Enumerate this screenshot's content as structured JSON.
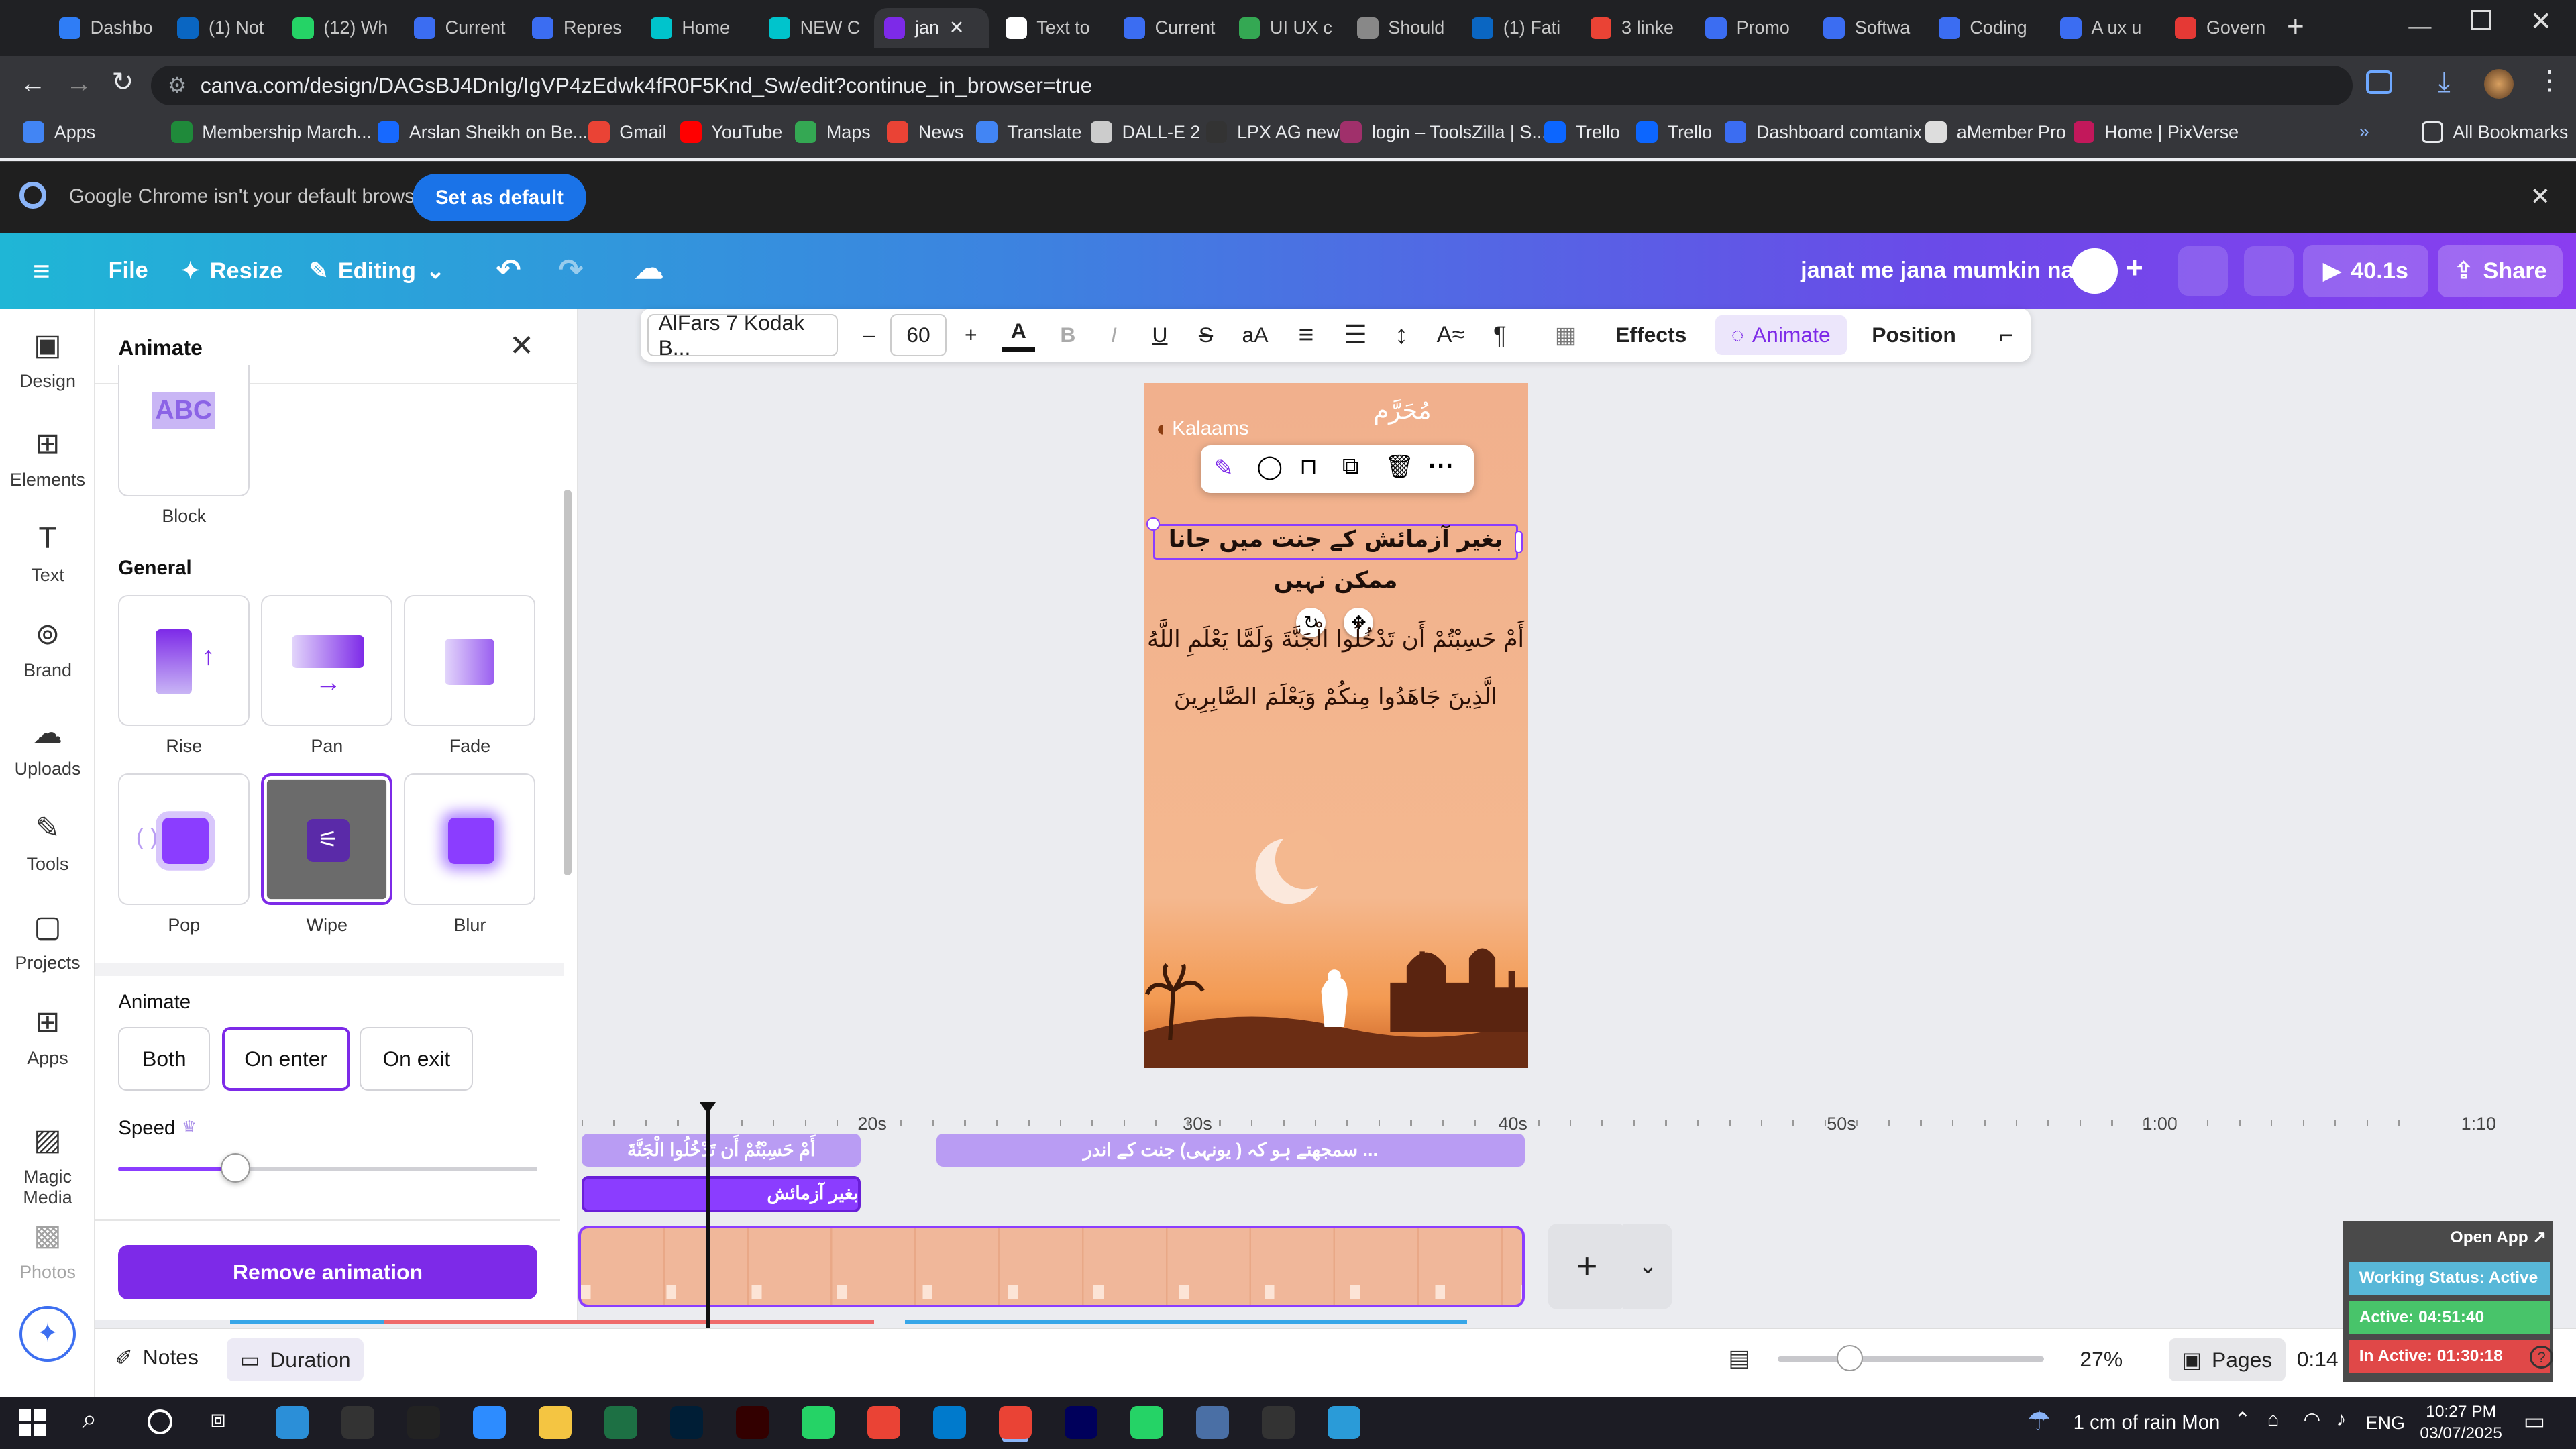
{
  "browser": {
    "tabs": [
      {
        "label": "Dashbo",
        "color": "#2f7df6"
      },
      {
        "label": "(1) Not",
        "color": "#0a66c2"
      },
      {
        "label": "(12) Wh",
        "color": "#25d366"
      },
      {
        "label": "Current",
        "color": "#3b6df2"
      },
      {
        "label": "Repres",
        "color": "#3b6df2"
      },
      {
        "label": "Home",
        "color": "#00c4cc"
      },
      {
        "label": "NEW C",
        "color": "#00c4cc"
      },
      {
        "label": "jan",
        "color": "#7d2ae8"
      },
      {
        "label": "Text to",
        "color": "#ffffff"
      },
      {
        "label": "Current",
        "color": "#3b6df2"
      },
      {
        "label": "UI UX c",
        "color": "#34a853"
      },
      {
        "label": "Should",
        "color": "#888888"
      },
      {
        "label": "(1) Fati",
        "color": "#0a66c2"
      },
      {
        "label": "3 linke",
        "color": "#ea4335"
      },
      {
        "label": "Promo",
        "color": "#3b6df2"
      },
      {
        "label": "Softwa",
        "color": "#3b6df2"
      },
      {
        "label": "Coding",
        "color": "#3b6df2"
      },
      {
        "label": "A ux u",
        "color": "#3b6df2"
      },
      {
        "label": "Govern",
        "color": "#e53935"
      }
    ],
    "url": "canva.com/design/DAGsBJ4DnIg/IgVP4zEdwk4fR0F5Knd_Sw/edit?continue_in_browser=true",
    "bookmarks": [
      "Apps",
      "Membership March...",
      "Arslan Sheikh on Be...",
      "Gmail",
      "YouTube",
      "Maps",
      "News",
      "Translate",
      "DALL-E 2",
      "LPX AG new",
      "login – ToolsZilla | S...",
      "Trello",
      "Trello",
      "Dashboard comtanix",
      "aMember Pro",
      "Home | PixVerse"
    ],
    "all_bookmarks": "All Bookmarks",
    "infobar_text": "Google Chrome isn't your default browser",
    "infobar_button": "Set as default"
  },
  "header": {
    "file": "File",
    "resize": "Resize",
    "editing": "Editing",
    "title": "janat me jana mumkin nai",
    "play_time": "40.1s",
    "share": "Share"
  },
  "rail": [
    "Design",
    "Elements",
    "Text",
    "Brand",
    "Uploads",
    "Tools",
    "Projects",
    "Apps",
    "Magic Media",
    "Photos"
  ],
  "panel": {
    "title": "Animate",
    "block_label": "Block",
    "block_preview": "ABC",
    "general_heading": "General",
    "effects": [
      "Rise",
      "Pan",
      "Fade",
      "Pop",
      "Wipe",
      "Blur"
    ],
    "selected_effect": "Wipe",
    "animate_heading": "Animate",
    "animate_options": [
      "Both",
      "On enter",
      "On exit"
    ],
    "animate_selected": "On enter",
    "speed_label": "Speed",
    "speed_level": 0.28,
    "remove_button": "Remove animation"
  },
  "toolbar": {
    "font": "AlFars 7 Kodak B...",
    "minus": "–",
    "size": "60",
    "plus": "+",
    "effects": "Effects",
    "animate": "Animate",
    "position": "Position"
  },
  "design": {
    "logo": "Kalaams",
    "logo_right": "مُحَرَّم",
    "heading_line1": "بغیر آزمائش کے جنت میں جانا",
    "heading_line2": "ممکن نہیں",
    "verse_line1": "أَمْ حَسِبْتُمْ أَن تَدْخُلُوا الْجَنَّةَ وَلَمَّا يَعْلَمِ اللَّهُ",
    "verse_line2": "الَّذِينَ جَاهَدُوا مِنكُمْ وَيَعْلَمَ الصَّابِرِينَ"
  },
  "timeline": {
    "ticks": [
      "20s",
      "30s",
      "40s",
      "50s",
      "1:00",
      "1:10"
    ],
    "clip1": "أَمْ حَسِبْتُمْ أَن تَدْخُلُوا الْجَنَّةَ",
    "clip2": "بغیر آزمائش",
    "clip3": "... سمجھتے ہو کہ ( یونہی) جنت کے اندر"
  },
  "statusbar": {
    "notes": "Notes",
    "duration": "Duration",
    "zoom": "27%",
    "pages": "Pages",
    "time": "0:14"
  },
  "widget": {
    "open_app": "Open App ↗",
    "working_status": "Working Status: Active",
    "active": "Active: 04:51:40",
    "inactive": "In Active: 01:30:18"
  },
  "taskbar": {
    "weather": "1 cm of rain Mon",
    "lang": "ENG",
    "clock_time": "10:27 PM",
    "clock_date": "03/07/2025"
  }
}
